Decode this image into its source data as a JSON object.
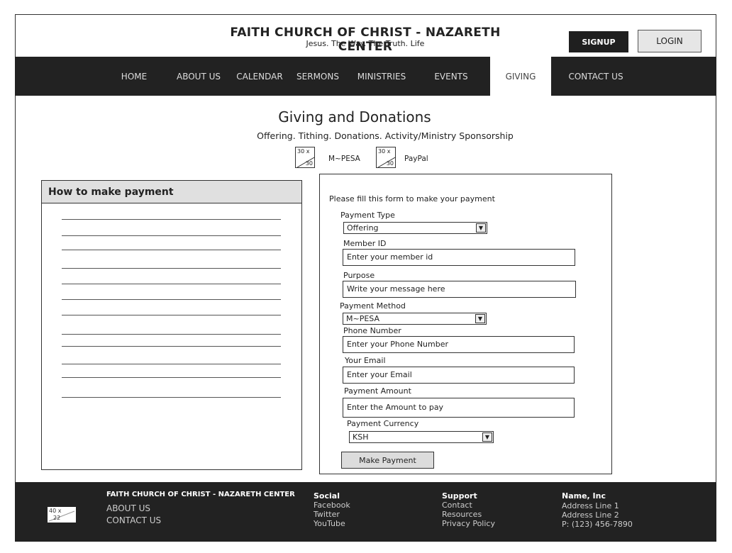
{
  "header": {
    "title": "FAITH CHURCH OF CHRIST - NAZARETH CENTER",
    "tagline": "Jesus. The Way. The Truth. Life",
    "signup_label": "SIGNUP",
    "login_label": "LOGIN"
  },
  "nav": {
    "items": [
      {
        "label": "HOME"
      },
      {
        "label": "ABOUT US"
      },
      {
        "label": "CALENDAR"
      },
      {
        "label": "SERMONS"
      },
      {
        "label": "MINISTRIES"
      },
      {
        "label": "EVENTS"
      },
      {
        "label": "GIVING",
        "active": true
      },
      {
        "label": "CONTACT US"
      }
    ]
  },
  "page": {
    "heading": "Giving and Donations",
    "subheading": "Offering. Tithing. Donations. Activity/Ministry Sponsorship",
    "methods": [
      {
        "placeholder_top": "30 x",
        "placeholder_bottom": "30",
        "label": "M~PESA"
      },
      {
        "placeholder_top": "30 x",
        "placeholder_bottom": "30",
        "label": "PayPal"
      }
    ]
  },
  "how_to": {
    "title": "How to make payment"
  },
  "form": {
    "intro": "Please fill this form to make your payment",
    "payment_type_label": "Payment Type",
    "payment_type_value": "Offering",
    "member_id_label": "Member ID",
    "member_id_placeholder": "Enter your member id",
    "purpose_label": "Purpose",
    "purpose_placeholder": "Write your message here",
    "payment_method_label": "Payment Method",
    "payment_method_value": "M~PESA",
    "phone_label": "Phone Number",
    "phone_placeholder": "Enter your Phone Number",
    "email_label": "Your Email",
    "email_placeholder": "Enter your Email",
    "amount_label": "Payment Amount",
    "amount_placeholder": "Enter the Amount to pay",
    "currency_label": "Payment Currency",
    "currency_value": "KSH",
    "submit_label": "Make Payment"
  },
  "footer": {
    "logo_top": "40 x",
    "logo_bottom": "22",
    "org_name": "FAITH CHURCH OF CHRIST - NAZARETH CENTER",
    "links": [
      "ABOUT US",
      "CONTACT US"
    ],
    "social_title": "Social",
    "social": [
      "Facebook",
      "Twitter",
      "YouTube"
    ],
    "support_title": "Support",
    "support": [
      "Contact",
      "Resources",
      "Privacy Policy"
    ],
    "company_title": "Name, Inc",
    "address": [
      "Address Line 1",
      "Address Line 2",
      "P: (123) 456-7890"
    ]
  }
}
